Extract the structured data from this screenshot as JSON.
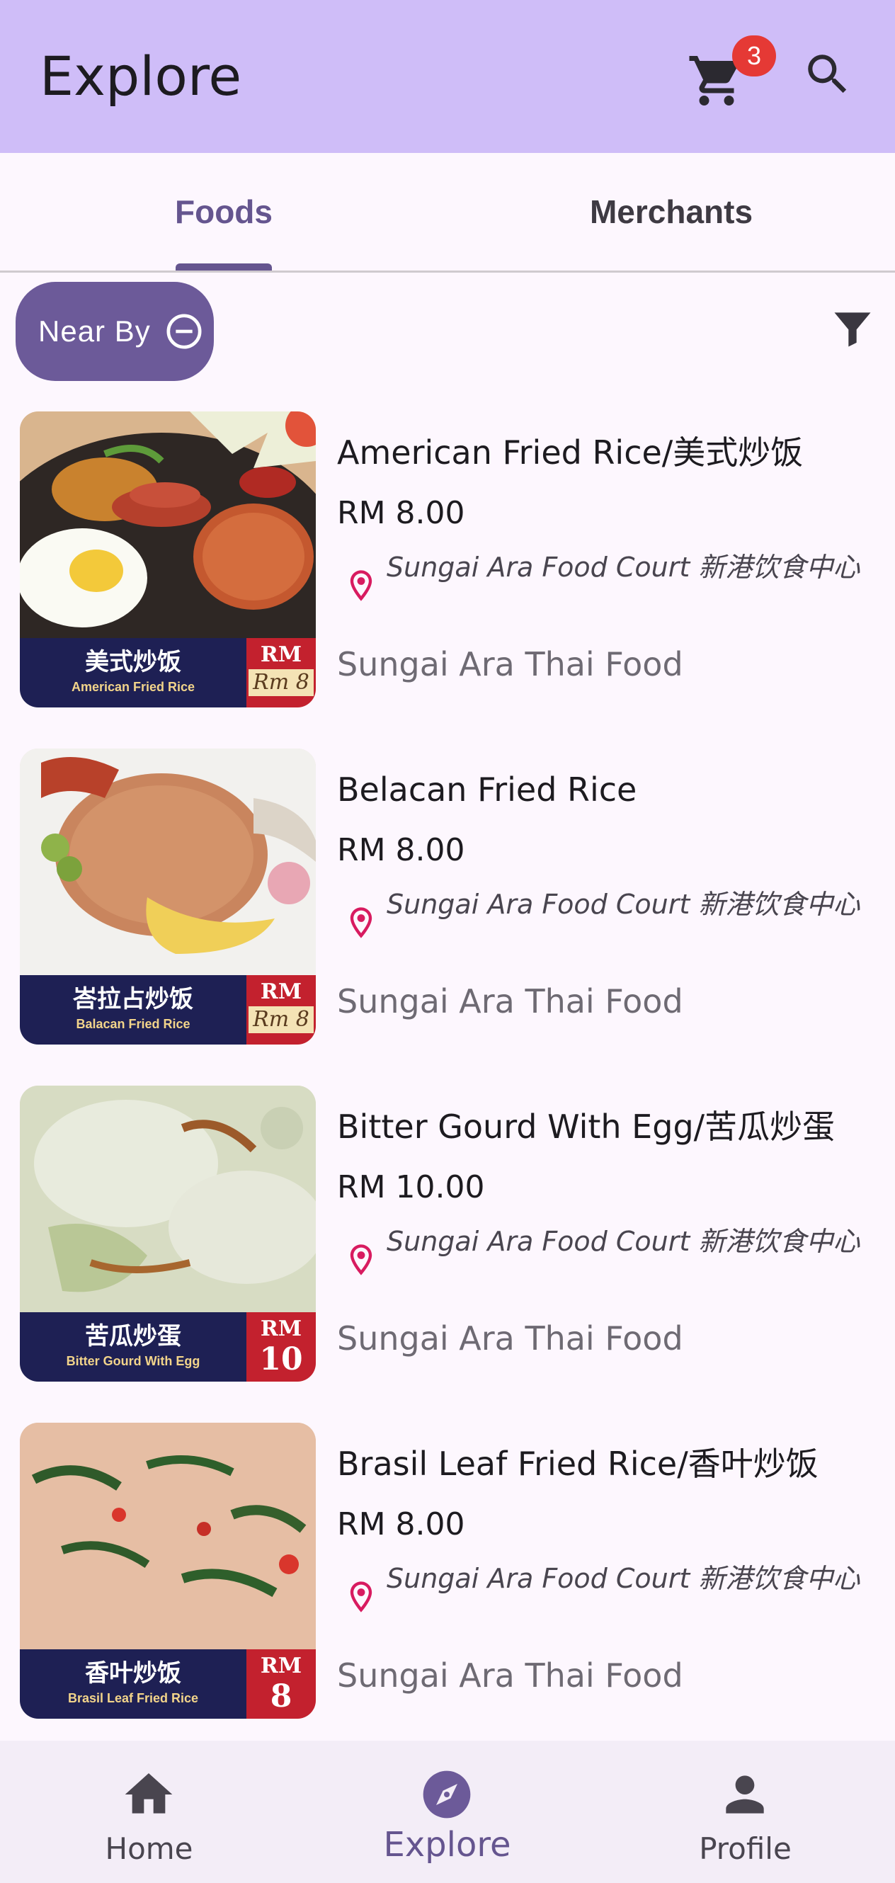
{
  "app_bar": {
    "title": "Explore",
    "cart_badge": "3",
    "background": "#CFBDF8"
  },
  "tabs": [
    {
      "label": "Foods",
      "active": true
    },
    {
      "label": "Merchants",
      "active": false
    }
  ],
  "filter_chip": {
    "label": "Near By",
    "icon": "remove-circle-icon"
  },
  "items": [
    {
      "name": "American Fried Rice/美式炒饭",
      "price": "RM 8.00",
      "location": "Sungai Ara Food Court 新港饮食中心",
      "merchant": "Sungai Ara Thai Food",
      "image": {
        "zh": "美式炒饭",
        "en": "American Fried Rice",
        "rm": "RM",
        "price_tag": "Rm 8"
      }
    },
    {
      "name": "Belacan Fried Rice",
      "price": "RM 8.00",
      "location": "Sungai Ara Food Court 新港饮食中心",
      "merchant": "Sungai Ara Thai Food",
      "image": {
        "zh": "峇拉占炒饭",
        "en": "Balacan Fried Rice",
        "rm": "RM",
        "price_tag": "Rm 8"
      }
    },
    {
      "name": "Bitter Gourd With Egg/苦瓜炒蛋",
      "price": "RM 10.00",
      "location": "Sungai Ara Food Court 新港饮食中心",
      "merchant": "Sungai Ara Thai Food",
      "image": {
        "zh": "苦瓜炒蛋",
        "en": "Bitter Gourd With Egg",
        "rm": "RM",
        "price_num": "10"
      }
    },
    {
      "name": "Brasil Leaf Fried Rice/香叶炒饭",
      "price": "RM 8.00",
      "location": "Sungai Ara Food Court 新港饮食中心",
      "merchant": "Sungai Ara Thai Food",
      "image": {
        "zh": "香叶炒饭",
        "en": "Brasil Leaf Fried Rice",
        "rm": "RM",
        "price_num": "8"
      }
    }
  ],
  "bottom_nav": [
    {
      "label": "Home",
      "icon": "home-icon",
      "active": false
    },
    {
      "label": "Explore",
      "icon": "compass-icon",
      "active": true
    },
    {
      "label": "Profile",
      "icon": "person-icon",
      "active": false
    }
  ],
  "colors": {
    "primary": "#65558F",
    "chip": "#6C5A99",
    "pin": "#D81B60",
    "badge": "#E53935"
  }
}
